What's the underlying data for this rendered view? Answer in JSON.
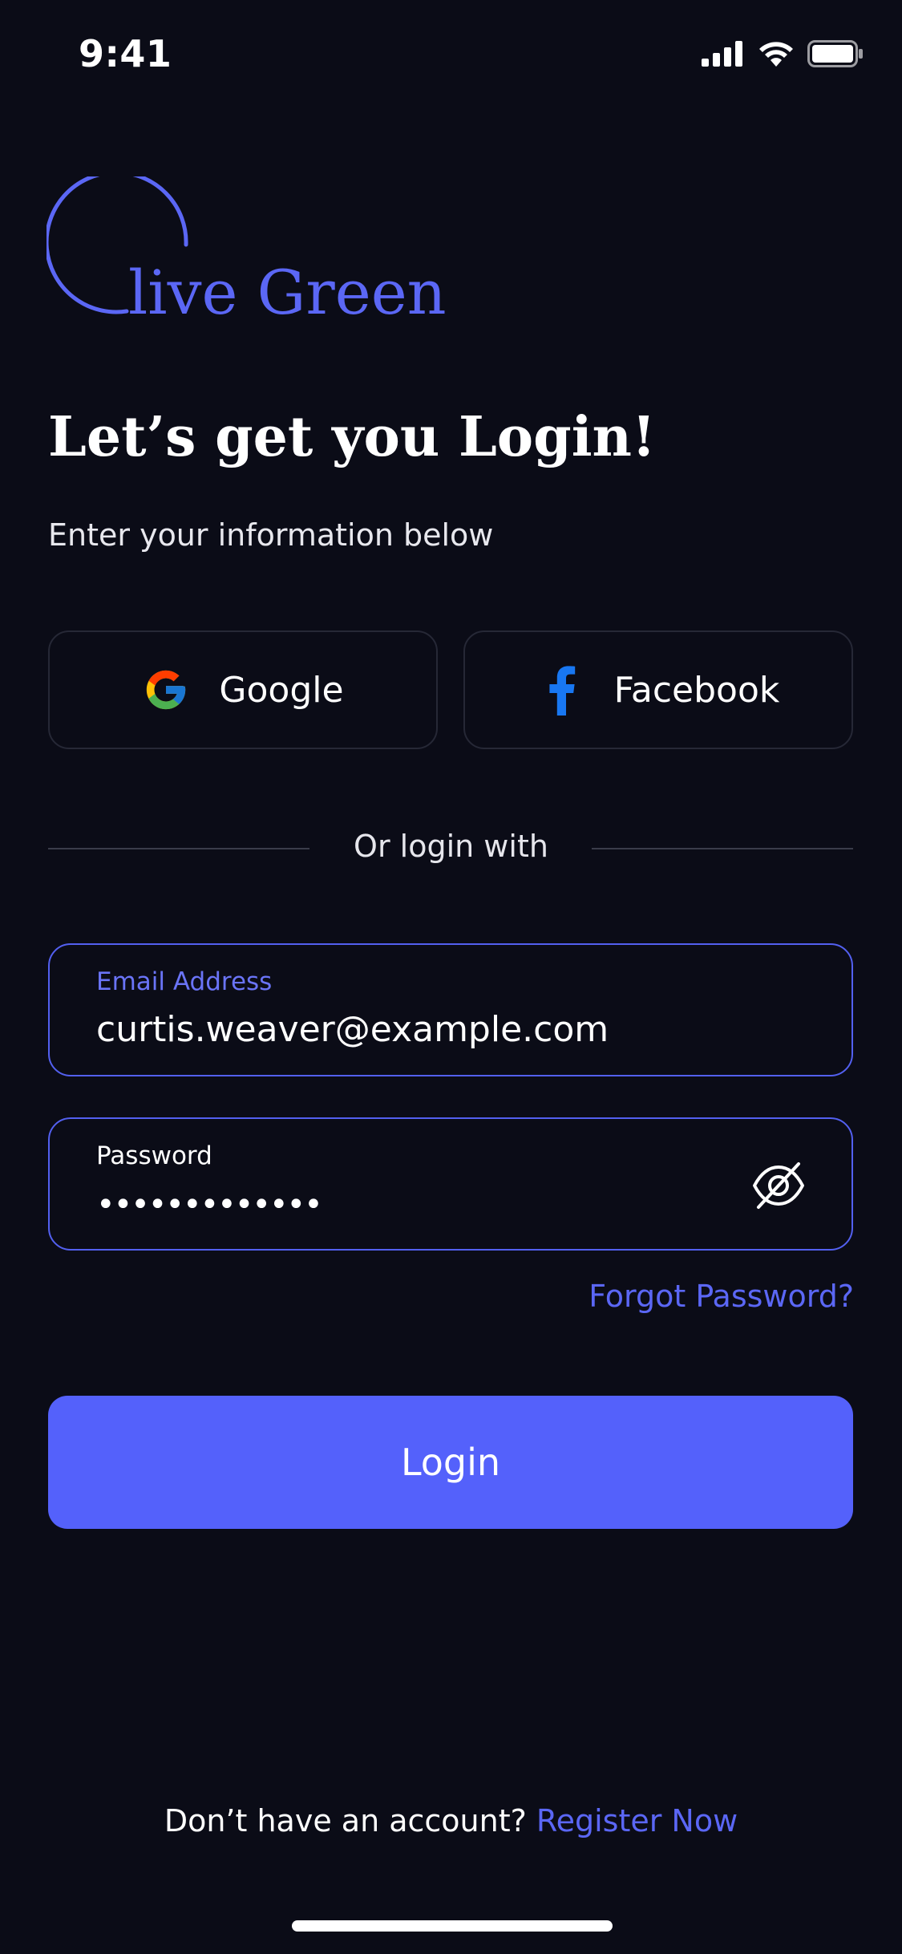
{
  "status_bar": {
    "time": "9:41",
    "icons": [
      "cellular-signal-icon",
      "wifi-icon",
      "battery-icon"
    ]
  },
  "logo": {
    "text": "live Green",
    "color": "#5b67f5"
  },
  "header": {
    "title": "Let’s get you Login!",
    "subtitle": "Enter your information below"
  },
  "social": {
    "google_label": "Google",
    "facebook_label": "Facebook"
  },
  "divider": {
    "text": "Or login with"
  },
  "form": {
    "email": {
      "label": "Email Address",
      "value": "curtis.weaver@example.com"
    },
    "password": {
      "label": "Password",
      "value": "•••••••••••••"
    },
    "forgot_label": "Forgot Password?",
    "login_label": "Login"
  },
  "footer": {
    "prompt": "Don’t have an account?",
    "register_label": "Register Now"
  },
  "colors": {
    "background": "#0b0c17",
    "accent": "#5461fb",
    "field_border": "#5360f0"
  }
}
